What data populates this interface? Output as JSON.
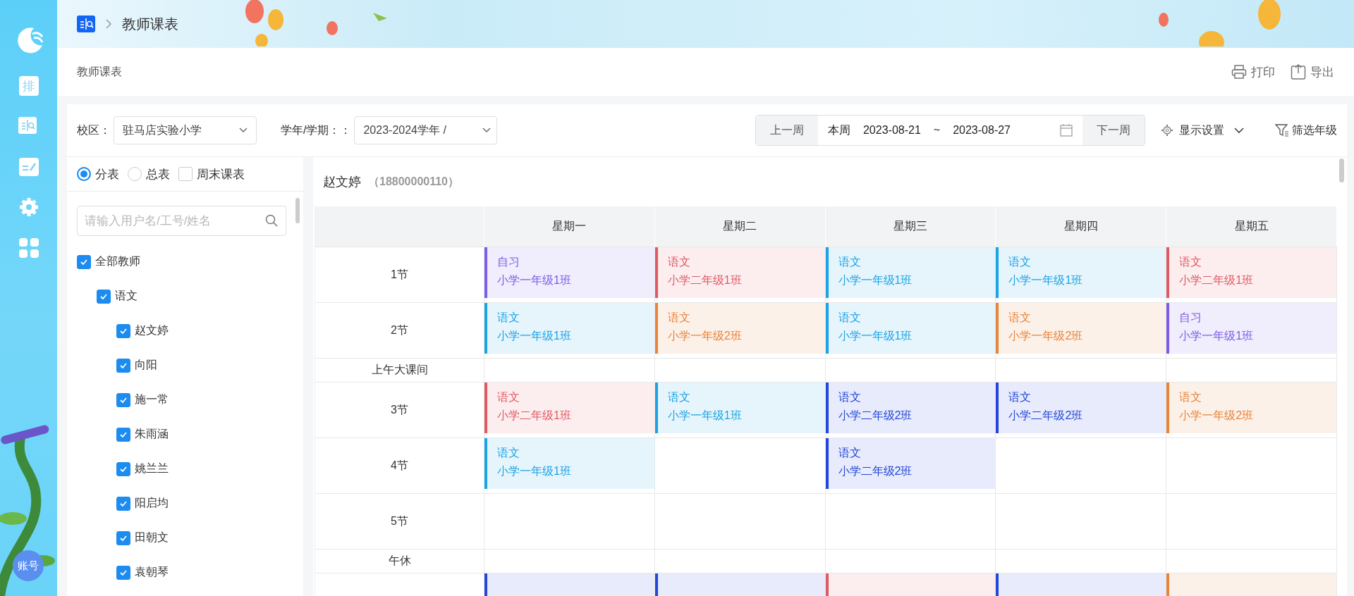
{
  "sidebar": {
    "schedule_badge": "排",
    "account_button": "账号"
  },
  "breadcrumb": {
    "current": "教师课表"
  },
  "page_title": "教师课表",
  "actions": [
    {
      "label": "打印",
      "kind": "print"
    },
    {
      "label": "导出",
      "kind": "export"
    }
  ],
  "filters": {
    "campus": {
      "label": "校区：",
      "value": "驻马店实验小学"
    },
    "term": {
      "label": "学年/学期：：",
      "value": "2023-2024学年 /"
    }
  },
  "week": {
    "prev": "上一周",
    "current_label": "本周",
    "start": "2023-08-21",
    "separator": "~",
    "end": "2023-08-27",
    "next": "下一周"
  },
  "display_settings": "显示设置",
  "grade_filter": "筛选年级",
  "view_options": [
    {
      "label": "分表",
      "kind": "radio",
      "checked": true
    },
    {
      "label": "总表",
      "kind": "radio",
      "checked": false
    },
    {
      "label": "周末课表",
      "kind": "checkbox",
      "checked": false
    }
  ],
  "search": {
    "placeholder": "请输入用户名/工号/姓名"
  },
  "tree": [
    {
      "label": "全部教师",
      "checked": true,
      "children": [
        {
          "label": "语文",
          "checked": true,
          "children": [
            {
              "label": "赵文婷",
              "checked": true
            },
            {
              "label": "向阳",
              "checked": true
            },
            {
              "label": "施一常",
              "checked": true
            },
            {
              "label": "朱雨涵",
              "checked": true
            },
            {
              "label": "姚兰兰",
              "checked": true
            },
            {
              "label": "阳启均",
              "checked": true
            },
            {
              "label": "田朝文",
              "checked": true
            },
            {
              "label": "袁朝琴",
              "checked": true
            }
          ]
        }
      ]
    }
  ],
  "teacher": {
    "name": "赵文婷",
    "phone": "（18800000110）"
  },
  "table": {
    "columns": [
      "星期一",
      "星期二",
      "星期三",
      "星期四",
      "星期五"
    ],
    "rows": [
      {
        "label": "1节",
        "kind": "period",
        "cells": [
          {
            "subject": "自习",
            "class": "小学一年级1班",
            "color": "#7b5ce8"
          },
          {
            "subject": "语文",
            "class": "小学二年级1班",
            "color": "#e05a64"
          },
          {
            "subject": "语文",
            "class": "小学一年级1班",
            "color": "#1ba3e6"
          },
          {
            "subject": "语文",
            "class": "小学一年级1班",
            "color": "#1ba3e6"
          },
          {
            "subject": "语文",
            "class": "小学二年级1班",
            "color": "#e05a64"
          }
        ]
      },
      {
        "label": "2节",
        "kind": "period",
        "cells": [
          {
            "subject": "语文",
            "class": "小学一年级1班",
            "color": "#1ba3e6"
          },
          {
            "subject": "语文",
            "class": "小学一年级2班",
            "color": "#e8843a"
          },
          {
            "subject": "语文",
            "class": "小学一年级1班",
            "color": "#1ba3e6"
          },
          {
            "subject": "语文",
            "class": "小学一年级2班",
            "color": "#e8843a"
          },
          {
            "subject": "自习",
            "class": "小学一年级1班",
            "color": "#7b5ce8"
          }
        ]
      },
      {
        "label": "上午大课间",
        "kind": "break",
        "cells": [
          null,
          null,
          null,
          null,
          null
        ]
      },
      {
        "label": "3节",
        "kind": "period",
        "cells": [
          {
            "subject": "语文",
            "class": "小学二年级1班",
            "color": "#e05a64"
          },
          {
            "subject": "语文",
            "class": "小学一年级1班",
            "color": "#1ba3e6"
          },
          {
            "subject": "语文",
            "class": "小学二年级2班",
            "color": "#2347d8"
          },
          {
            "subject": "语文",
            "class": "小学二年级2班",
            "color": "#2347d8"
          },
          {
            "subject": "语文",
            "class": "小学一年级2班",
            "color": "#e8843a"
          }
        ]
      },
      {
        "label": "4节",
        "kind": "period",
        "cells": [
          {
            "subject": "语文",
            "class": "小学一年级1班",
            "color": "#1ba3e6"
          },
          null,
          {
            "subject": "语文",
            "class": "小学二年级2班",
            "color": "#2347d8"
          },
          null,
          null
        ]
      },
      {
        "label": "5节",
        "kind": "period",
        "cells": [
          null,
          null,
          null,
          null,
          null
        ]
      },
      {
        "label": "午休",
        "kind": "break",
        "cells": [
          null,
          null,
          null,
          null,
          null
        ]
      },
      {
        "kind": "period",
        "cells": [
          {
            "color": "#2347d8"
          },
          {
            "color": "#2347d8"
          },
          {
            "color": "#e05a64"
          },
          {
            "color": "#2347d8"
          },
          {
            "color": "#e8843a"
          }
        ]
      }
    ]
  }
}
